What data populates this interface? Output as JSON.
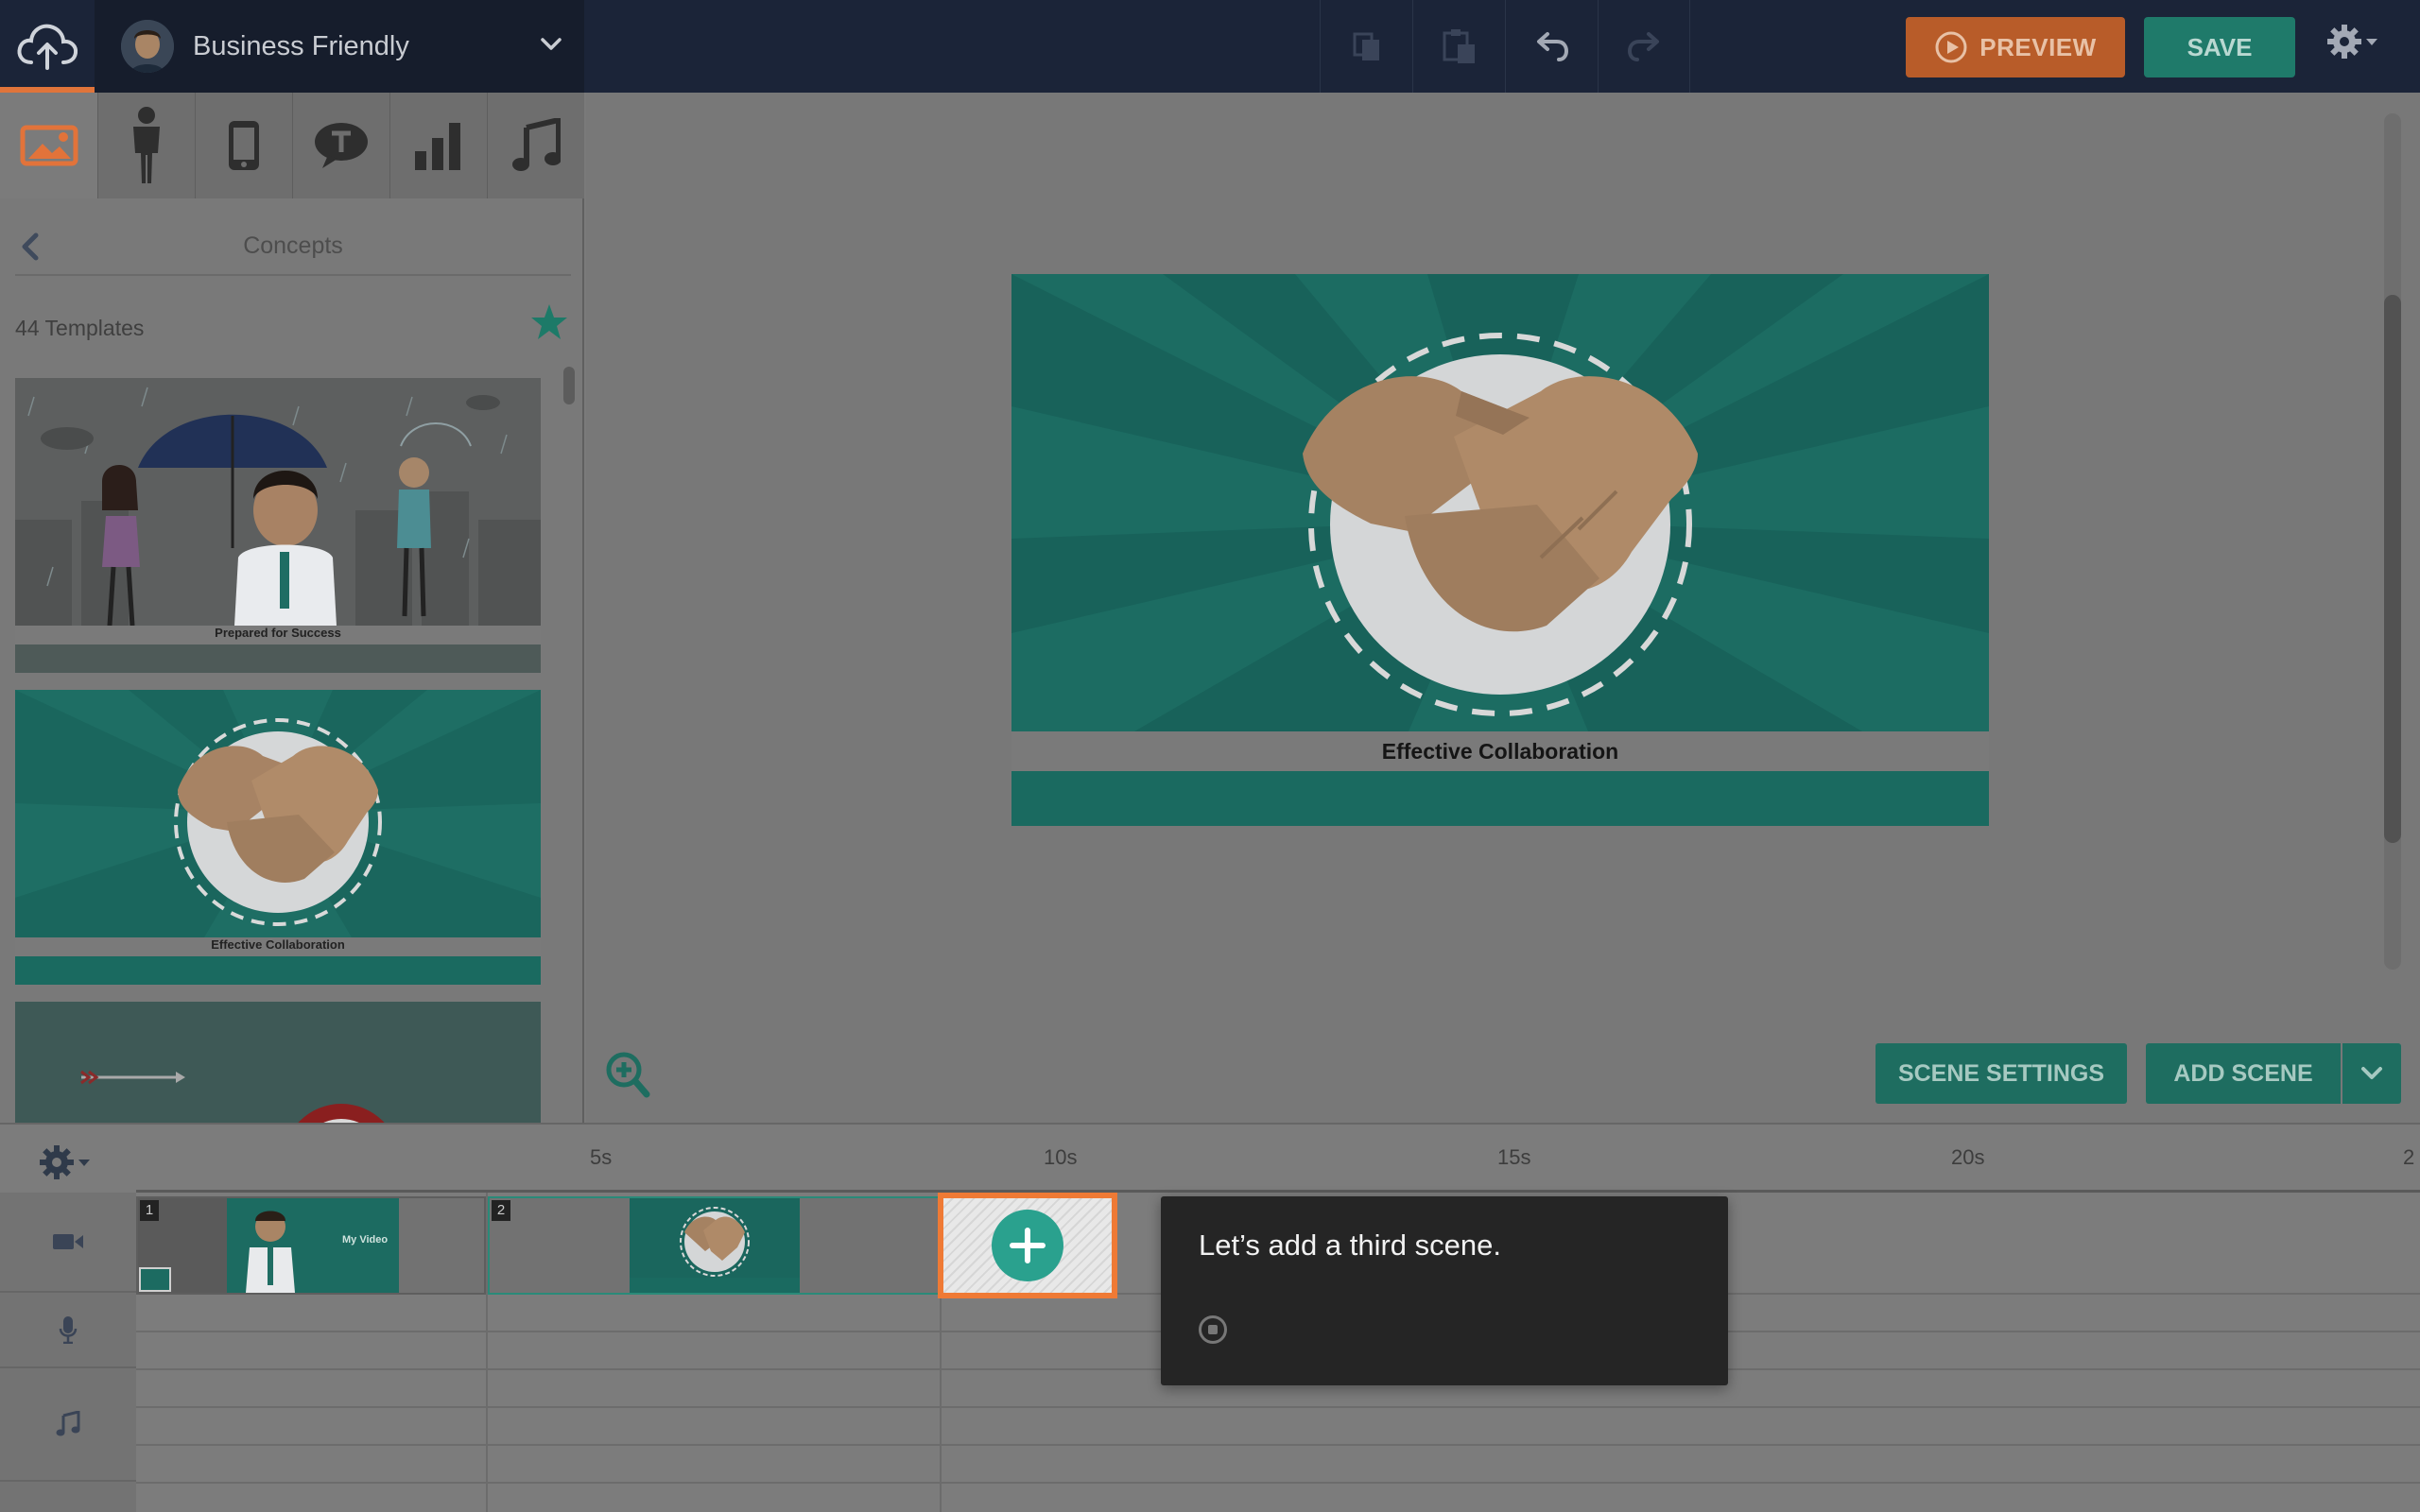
{
  "topbar": {
    "theme_name": "Business Friendly",
    "preview_label": "PREVIEW",
    "save_label": "SAVE"
  },
  "library": {
    "tabs": [
      "image-icon",
      "character-icon",
      "phone-icon",
      "speech-bubble-icon",
      "chart-icon",
      "music-note-icon"
    ],
    "panel_title": "Concepts",
    "template_count": "44 Templates",
    "templates": [
      {
        "caption": "Prepared for Success"
      },
      {
        "caption": "Effective Collaboration"
      },
      {
        "caption": ""
      }
    ]
  },
  "stage": {
    "canvas_caption": "Effective Collaboration",
    "scene_settings_label": "SCENE SETTINGS",
    "add_scene_label": "ADD SCENE"
  },
  "timeline": {
    "ruler_labels": [
      "5s",
      "10s",
      "15s",
      "20s",
      "2"
    ],
    "scenes": [
      {
        "number": "1",
        "caption": "My Video"
      },
      {
        "number": "2"
      }
    ]
  },
  "tooltip": {
    "text": "Let’s add a third scene."
  },
  "colors": {
    "accent_orange": "#ef7a35",
    "brand_teal": "#1f7a6a",
    "topbar_bg": "#1b2438"
  }
}
